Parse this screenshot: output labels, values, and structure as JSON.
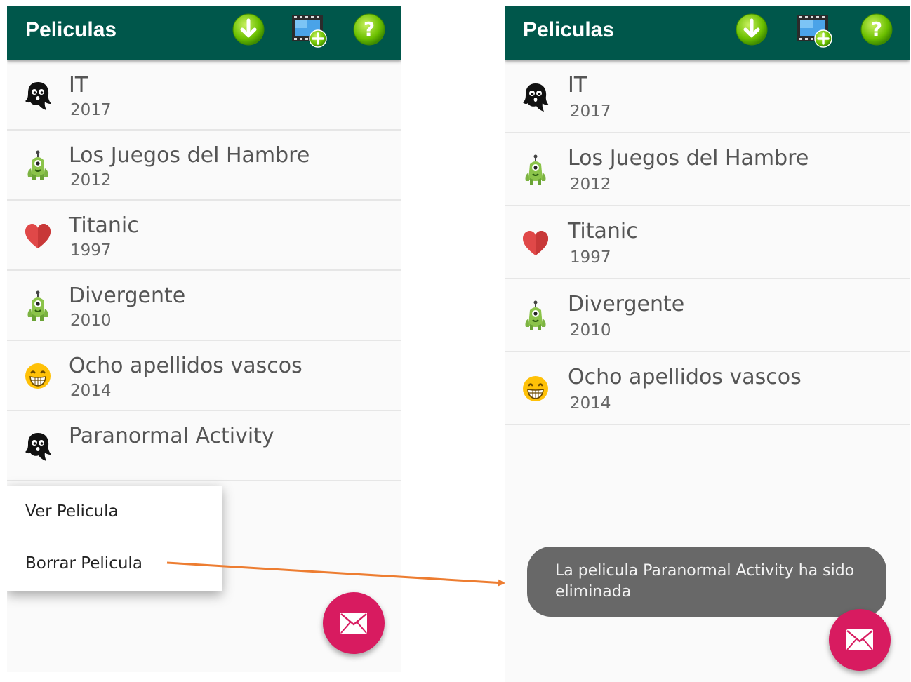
{
  "screens": [
    {
      "title": "Peliculas",
      "movies": [
        {
          "title": "IT",
          "year": "2017",
          "icon": "ghost-icon"
        },
        {
          "title": "Los Juegos del Hambre",
          "year": "2012",
          "icon": "alien-icon"
        },
        {
          "title": "Titanic",
          "year": "1997",
          "icon": "heart-icon"
        },
        {
          "title": "Divergente",
          "year": "2010",
          "icon": "alien-icon"
        },
        {
          "title": "Ocho apellidos vascos",
          "year": "2014",
          "icon": "laughing-face-icon"
        },
        {
          "title": "Paranormal Activity",
          "year": "",
          "icon": "ghost-icon"
        }
      ],
      "context_menu": {
        "items": [
          "Ver Pelicula",
          "Borrar Pelicula"
        ]
      }
    },
    {
      "title": "Peliculas",
      "movies": [
        {
          "title": "IT",
          "year": "2017",
          "icon": "ghost-icon"
        },
        {
          "title": "Los Juegos del Hambre",
          "year": "2012",
          "icon": "alien-icon"
        },
        {
          "title": "Titanic",
          "year": "1997",
          "icon": "heart-icon"
        },
        {
          "title": "Divergente",
          "year": "2010",
          "icon": "alien-icon"
        },
        {
          "title": "Ocho apellidos vascos",
          "year": "2014",
          "icon": "laughing-face-icon"
        }
      ],
      "toast": "La pelicula Paranormal Activity  ha sido eliminada"
    }
  ],
  "toolbar_icons": [
    "download-icon",
    "add-movie-icon",
    "help-icon"
  ],
  "colors": {
    "appbar": "#00574b",
    "fab": "#d81b60",
    "icon_green": "#7cc800",
    "heart": "#e04848",
    "toast": "#686868",
    "arrow": "#ed7d31"
  }
}
